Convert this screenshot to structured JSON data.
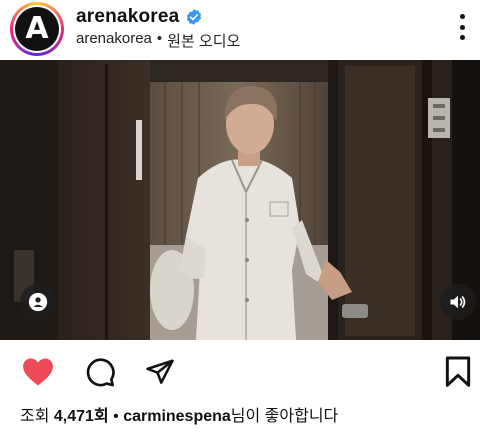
{
  "post": {
    "username": "arenakorea",
    "avatar_letter": "A",
    "subtitle_account": "arenakorea",
    "subtitle_separator": "•",
    "subtitle_audio": "원본 오디오"
  },
  "icons": {
    "verified": "verified-badge-icon",
    "more": "more-vertical-icon",
    "tag": "tagged-user-icon",
    "sound": "volume-icon",
    "like": "heart-filled-icon",
    "comment": "comment-icon",
    "share": "send-icon",
    "save": "bookmark-icon"
  },
  "colors": {
    "like": "#ed4956",
    "verified": "#3897f0"
  },
  "stats": {
    "views_prefix": "조회",
    "views_count": "4,471회",
    "separator": "•",
    "liked_by_user": "carminespena",
    "liked_suffix": "님이 좋아합니다"
  }
}
